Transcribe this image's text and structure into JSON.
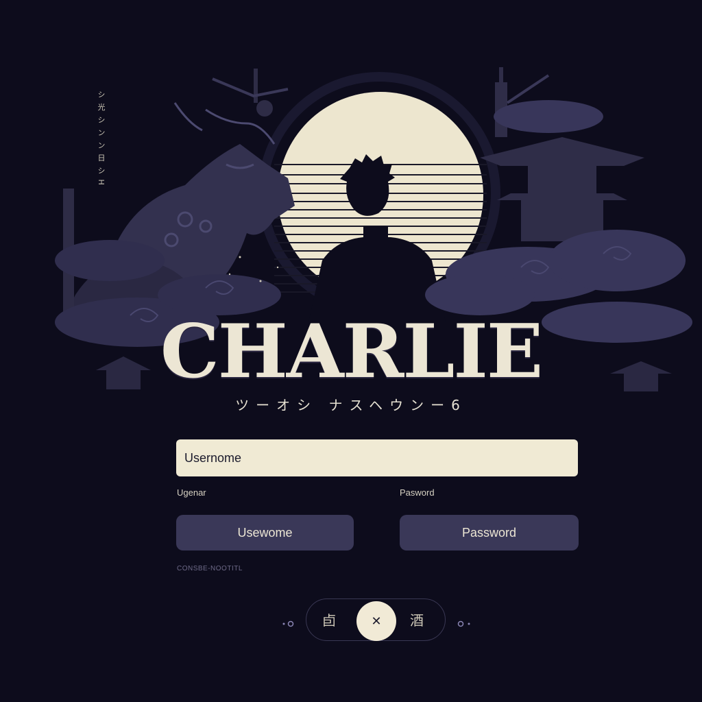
{
  "hero": {
    "vertical_text": "シ 光 シ ン ン 日 シ H",
    "title": "CHARLIE",
    "subtitle": "ツーオシ ナスヘウンー6"
  },
  "form": {
    "username_main_placeholder": "Usernome",
    "username_label": "Ugenar",
    "password_label": "Pasword",
    "username_button": "Usewome",
    "password_button": "Password",
    "small_link": "CONSBE-NOOTITL"
  },
  "pager": {
    "left_glyph": "卣",
    "center_icon_text": "✕",
    "right_glyph": "酒"
  },
  "colors": {
    "background": "#0d0c1c",
    "accent_cream": "#f0ead4",
    "button_fill": "#3a3858"
  }
}
